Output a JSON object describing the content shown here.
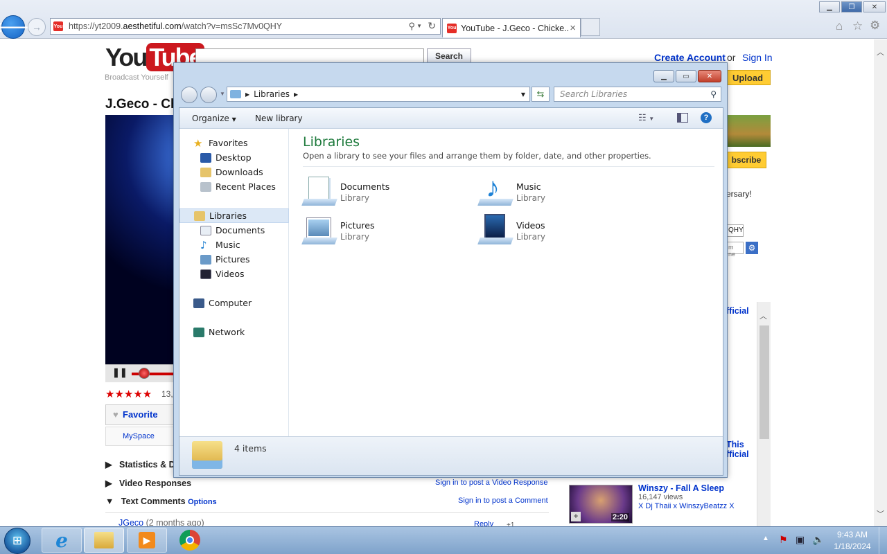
{
  "browser": {
    "url_prefix": "https://yt2009.",
    "url_domain": "aesthetiful.com",
    "url_path": "/watch?v=msSc7Mv0QHY",
    "tab_title": "YouTube - J.Geco - Chicke...",
    "tab_close": "×"
  },
  "youtube": {
    "logo_you": "You",
    "logo_tube": "Tube",
    "tagline": "Broadcast Yourself",
    "search_button": "Search",
    "create_account": "Create Account",
    "or": "or",
    "sign_in": "Sign In",
    "upload": "Upload",
    "video_title": "J.Geco - Ch",
    "subscribe": "bscribe",
    "side_text": "ersary!",
    "embed_partial": "QHY",
    "embed_input": "m ne",
    "rating_count": "13,",
    "favorite": "Favorite",
    "myspace": "MySpace",
    "stats_label": "Statistics & Da",
    "video_responses": "Video Responses",
    "sign_in_video_response": "Sign in to post a Video Response",
    "text_comments": "Text Comments",
    "options": "Options",
    "sign_in_comment": "Sign in to post a Comment",
    "comment_user": "JGeco",
    "comment_time": "(2 months ago)",
    "reply": "Reply",
    "reply_count": "+1",
    "related_partial1": "fficial",
    "related_partial2": "This",
    "related_partial3": "fficial",
    "related_title": "Winszy - Fall A Sleep",
    "related_views": "16,147 views",
    "related_uploader": "X Dj Thaii x WinszyBeatzz X",
    "related_duration": "2:20"
  },
  "explorer": {
    "breadcrumb": "Libraries",
    "search_placeholder": "Search Libraries",
    "organize": "Organize",
    "new_library": "New library",
    "header_title": "Libraries",
    "header_desc": "Open a library to see your files and arrange them by folder, date, and other properties.",
    "nav": {
      "favorites": "Favorites",
      "desktop": "Desktop",
      "downloads": "Downloads",
      "recent": "Recent Places",
      "libraries": "Libraries",
      "documents": "Documents",
      "music": "Music",
      "pictures": "Pictures",
      "videos": "Videos",
      "computer": "Computer",
      "network": "Network"
    },
    "libraries": [
      {
        "name": "Documents",
        "type": "Library"
      },
      {
        "name": "Music",
        "type": "Library"
      },
      {
        "name": "Pictures",
        "type": "Library"
      },
      {
        "name": "Videos",
        "type": "Library"
      }
    ],
    "status": "4 items"
  },
  "taskbar": {
    "clock_time": "9:43 AM",
    "clock_date": "1/18/2024"
  },
  "colors": {
    "accent_title": "#1e7a3c",
    "link_blue": "#0033cc",
    "upload_yellow": "#ffcc33"
  }
}
